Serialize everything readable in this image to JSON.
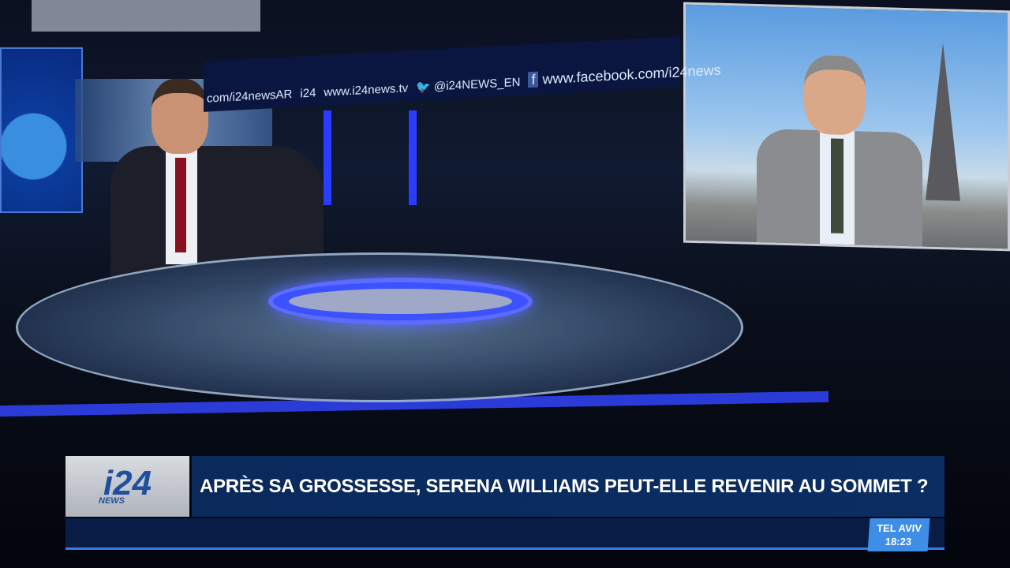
{
  "studio_ticker": {
    "items": [
      "com/i24newsAR",
      "i24",
      "www.i24news.tv",
      "@i24NEWS_EN",
      "www.facebook.com/i24news"
    ]
  },
  "lower_third": {
    "logo_text": "i24",
    "logo_sub": "NEWS",
    "headline": "APRÈS SA GROSSESSE, SERENA WILLIAMS PEUT-ELLE REVENIR AU SOMMET ?",
    "clock_city": "TEL AVIV",
    "clock_time": "18:23"
  },
  "colors": {
    "brand_blue": "#1f4f9e",
    "headline_bg": "#0a2a5c",
    "clock_bg": "#3e8ee8"
  }
}
